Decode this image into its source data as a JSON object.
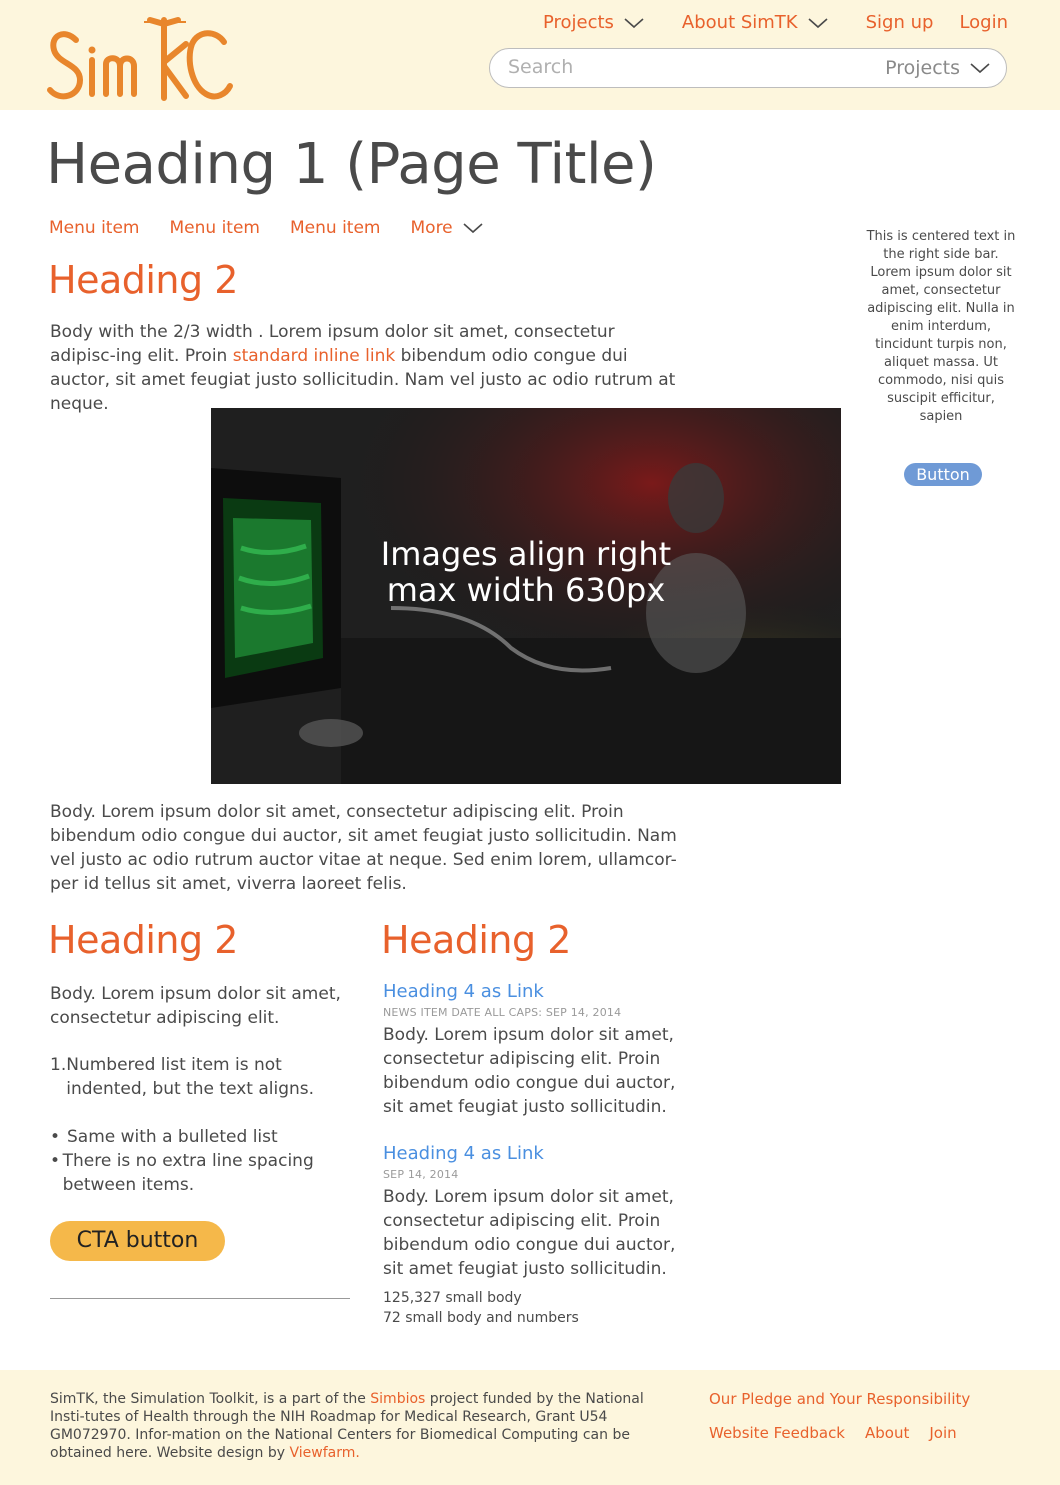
{
  "header": {
    "brand": "SimTK",
    "nav": {
      "projects": "Projects",
      "about": "About SimTK",
      "signup": "Sign up",
      "login": "Login"
    },
    "search": {
      "placeholder": "Search",
      "scope": "Projects"
    }
  },
  "page": {
    "title": "Heading 1 (Page Title)",
    "subnav": [
      "Menu item",
      "Menu item",
      "Menu item",
      "More"
    ]
  },
  "main": {
    "heading": "Heading 2",
    "intro_before": "Body with the 2/3 width . Lorem ipsum dolor sit amet, consectetur adipisc-ing elit. Proin ",
    "intro_link": "standard inline link",
    "intro_after": " bibendum odio congue dui auctor, sit amet feugiat justo sollicitudin. Nam vel justo ac odio rutrum at neque.",
    "image_caption_line1": "Images align right",
    "image_caption_line2": "max width 630px",
    "body2": "Body. Lorem ipsum dolor sit amet, consectetur adipiscing elit. Proin bibendum odio congue dui auctor, sit amet feugiat justo sollicitudin. Nam vel justo ac odio rutrum auctor vitae at neque. Sed enim lorem, ullamcor-per id tellus sit amet, viverra laoreet felis."
  },
  "left_col": {
    "heading": "Heading 2",
    "body": "Body. Lorem ipsum dolor sit amet, consectetur adipiscing elit.",
    "numbered": [
      "Numbered list item is not indented, but the text aligns."
    ],
    "bullets": [
      "Same with a bulleted list",
      "There is no extra line spacing between items."
    ],
    "cta": "CTA button"
  },
  "right_col": {
    "heading": "Heading 2",
    "news": [
      {
        "title": "Heading 4 as Link",
        "meta": "NEWS ITEM DATE ALL CAPS: SEP 14, 2014",
        "body": "Body. Lorem ipsum dolor sit amet, consectetur adipiscing elit. Proin bibendum odio congue dui auctor, sit amet feugiat justo sollicitudin."
      },
      {
        "title": "Heading 4 as Link",
        "meta": "SEP 14, 2014",
        "body": "Body. Lorem ipsum dolor sit amet, consectetur adipiscing elit. Proin bibendum odio congue dui auctor, sit amet feugiat justo sollicitudin."
      }
    ],
    "small1": "125,327 small body",
    "small2": "72 small body and numbers"
  },
  "sidebar": {
    "text": "This is centered text in the right side bar. Lorem ipsum dolor sit amet, consectetur adipiscing elit. Nulla in enim interdum, tincidunt turpis non, aliquet massa. Ut commodo, nisi quis suscipit efficitur, sapien",
    "button": "Button"
  },
  "footer": {
    "text_before": "SimTK, the Simulation Toolkit, is a part of the ",
    "simbios": "Simbios",
    "text_mid": " project funded by the National Insti-tutes of Health through the NIH Roadmap for Medical Research, Grant U54 GM072970. Infor-mation on the National Centers for Biomedical Computing can be obtained here. Website design by ",
    "viewfarm": "Viewfarm.",
    "pledge": "Our Pledge and Your Responsibility",
    "feedback": "Website Feedback",
    "about": "About",
    "join": "Join"
  },
  "colors": {
    "accent": "#e8612c",
    "header_bg": "#fdf6dd",
    "link_blue": "#4a8fe0",
    "cta": "#f5b84a",
    "side_button": "#6f9ad6"
  }
}
